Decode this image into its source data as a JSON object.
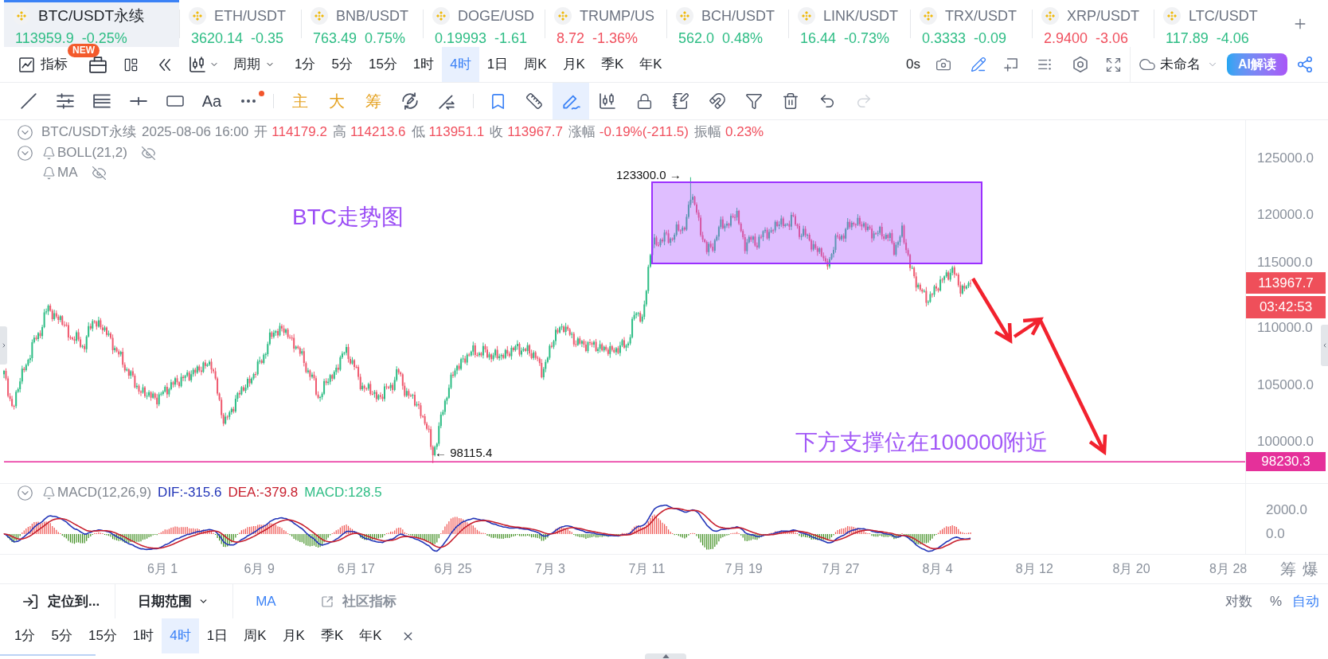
{
  "tickers": [
    {
      "symbol": "BTC/USDT永续",
      "price": "113959.9",
      "change": "-0.25%",
      "color": "#2ebd85",
      "selected": true,
      "badge": "NEW"
    },
    {
      "symbol": "ETH/USDT",
      "price": "3620.14",
      "change": "-0.35",
      "color": "#2ebd85",
      "selected": false
    },
    {
      "symbol": "BNB/USDT",
      "price": "763.49",
      "change": "0.75%",
      "color": "#2ebd85",
      "selected": false
    },
    {
      "symbol": "DOGE/USD",
      "price": "0.19993",
      "change": "-1.61",
      "color": "#2ebd85",
      "selected": false
    },
    {
      "symbol": "TRUMP/US",
      "price": "8.72",
      "change": "-1.36%",
      "color": "#f0505e",
      "selected": false
    },
    {
      "symbol": "BCH/USDT",
      "price": "562.0",
      "change": "0.48%",
      "color": "#2ebd85",
      "selected": false
    },
    {
      "symbol": "LINK/USDT",
      "price": "16.44",
      "change": "-0.73%",
      "color": "#2ebd85",
      "selected": false
    },
    {
      "symbol": "TRX/USDT",
      "price": "0.3333",
      "change": "-0.09",
      "color": "#2ebd85",
      "selected": false
    },
    {
      "symbol": "XRP/USDT",
      "price": "2.9400",
      "change": "-3.06",
      "color": "#f0505e",
      "selected": false
    },
    {
      "symbol": "LTC/USDT",
      "price": "117.89",
      "change": "-4.06",
      "color": "#2ebd85",
      "selected": false
    }
  ],
  "toolbar": {
    "indicators_button": "指标",
    "period_dropdown": "周期",
    "intervals": [
      {
        "label": "1分",
        "selected": false
      },
      {
        "label": "5分",
        "selected": false
      },
      {
        "label": "15分",
        "selected": false
      },
      {
        "label": "1时",
        "selected": false
      },
      {
        "label": "4时",
        "selected": true
      },
      {
        "label": "1日",
        "selected": false
      },
      {
        "label": "周K",
        "selected": false
      },
      {
        "label": "月K",
        "selected": false
      },
      {
        "label": "季K",
        "selected": false
      },
      {
        "label": "年K",
        "selected": false
      }
    ],
    "timer": "0s",
    "view_tools": [
      {
        "on": false
      },
      {
        "on": true
      },
      {
        "on": false
      },
      {
        "on": false
      },
      {
        "on": false
      },
      {
        "on": false
      }
    ],
    "layout_dropdown": "未命名",
    "ai_button": "AI解读"
  },
  "drawing_toolbar": {
    "shape_tools": [
      {
        "selected": false
      },
      {
        "selected": false
      },
      {
        "selected": false
      },
      {
        "selected": false
      },
      {
        "selected": false
      },
      {
        "label": "Aa",
        "selected": false
      }
    ],
    "more_button": {
      "dot": true
    },
    "overlay_tools": [
      {
        "label": "主",
        "selected": false
      },
      {
        "label": "大",
        "selected": false
      },
      {
        "label": "筹",
        "selected": false
      },
      {
        "selected": false
      },
      {
        "selected": false
      }
    ],
    "bookmark_toggle": {
      "on": true
    },
    "mark_tools": [
      {
        "selected": false
      },
      {
        "selected": true
      },
      {
        "selected": false
      },
      {
        "selected": false
      },
      {
        "selected": false
      },
      {
        "selected": false
      },
      {
        "selected": false
      },
      {
        "selected": false
      }
    ],
    "history": [
      {
        "disabled": false
      },
      {
        "disabled": true
      }
    ]
  },
  "legend": {
    "symbol": "BTC/USDT永续",
    "time": "2025-08-06 16:00",
    "fields": [
      {
        "label": "开",
        "value": "114179.2"
      },
      {
        "label": "高",
        "value": "114213.6"
      },
      {
        "label": "低",
        "value": "113951.1"
      },
      {
        "label": "收",
        "value": "113967.7"
      },
      {
        "label": "涨幅",
        "value": "-0.19%(-211.5)"
      },
      {
        "label": "振幅",
        "value": "0.23%"
      }
    ],
    "indicators": [
      {
        "name": "BOLL(21,2)",
        "collapse_toggle": true,
        "visible": false
      },
      {
        "name": "MA",
        "collapse_toggle": false,
        "visible": false
      }
    ]
  },
  "chart": {
    "title_note": "BTC走势图",
    "high_marker": "123300.0 →",
    "low_marker": "← 98115.4",
    "support_note": "下方支撑位在100000附近",
    "price_axis": [
      "125000.0",
      "120000.0",
      "115000.0",
      "110000.0",
      "105000.0",
      "100000.0"
    ],
    "last_price": "113967.7",
    "countdown": "03:42:53",
    "level_price": "98230.3"
  },
  "macd": {
    "name": "MACD(12,26,9)",
    "values": [
      {
        "label": "DIF:-315.6",
        "color": "#2336b8"
      },
      {
        "label": "DEA:-379.8",
        "color": "#c8202e"
      },
      {
        "label": "MACD:128.5",
        "color": "#2ebd85"
      }
    ],
    "axis": [
      "2000.0",
      "0.0"
    ]
  },
  "time_axis": {
    "labels": [
      "6月 1",
      "6月 9",
      "6月 17",
      "6月 25",
      "7月 3",
      "7月 11",
      "7月 19",
      "7月 27",
      "8月 4",
      "8月 12",
      "8月 20",
      "8月 28"
    ],
    "buttons": [
      "筹",
      "爆"
    ]
  },
  "bottom_bar": {
    "locate_button": "定位到...",
    "date_range_dropdown": "日期范围",
    "indicator_tabs": [
      {
        "label": "MA",
        "kind": "text",
        "selected": true
      },
      {
        "label": "社区指标",
        "kind": "icon_text",
        "selected": false
      }
    ],
    "scale_options": [
      {
        "label": "对数",
        "selected": false
      },
      {
        "label": "%",
        "selected": false
      },
      {
        "label": "自动",
        "selected": true
      }
    ],
    "intervals": [
      {
        "label": "1分",
        "selected": false
      },
      {
        "label": "5分",
        "selected": false
      },
      {
        "label": "15分",
        "selected": false
      },
      {
        "label": "1时",
        "selected": false
      },
      {
        "label": "4时",
        "selected": true
      },
      {
        "label": "1日",
        "selected": false
      },
      {
        "label": "周K",
        "selected": false
      },
      {
        "label": "月K",
        "selected": false
      },
      {
        "label": "季K",
        "selected": false
      },
      {
        "label": "年K",
        "selected": false
      }
    ]
  }
}
